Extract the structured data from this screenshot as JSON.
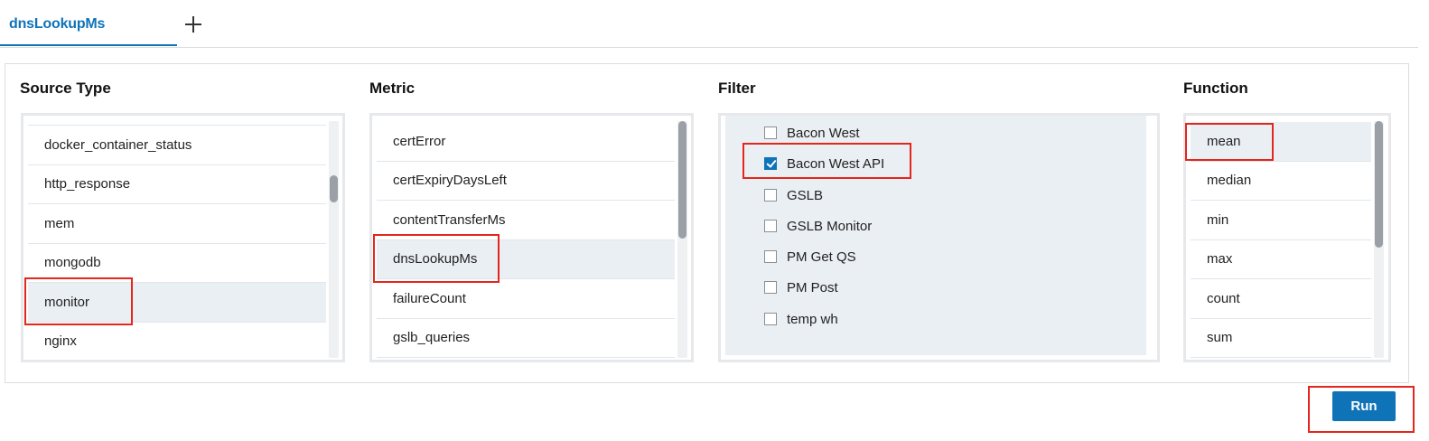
{
  "tabs": {
    "active_label": "dnsLookupMs",
    "add_icon": "plus-icon"
  },
  "source_type": {
    "title": "Source Type",
    "items": [
      "docker_container_status",
      "http_response",
      "mem",
      "mongodb",
      "monitor",
      "nginx"
    ],
    "selected": "monitor"
  },
  "metric": {
    "title": "Metric",
    "items": [
      "certError",
      "certExpiryDaysLeft",
      "contentTransferMs",
      "dnsLookupMs",
      "failureCount",
      "gslb_queries"
    ],
    "selected": "dnsLookupMs"
  },
  "filter": {
    "title": "Filter",
    "items": [
      {
        "label": "Bacon West",
        "checked": false
      },
      {
        "label": "Bacon West API",
        "checked": true
      },
      {
        "label": "GSLB",
        "checked": false
      },
      {
        "label": "GSLB Monitor",
        "checked": false
      },
      {
        "label": "PM Get QS",
        "checked": false
      },
      {
        "label": "PM Post",
        "checked": false
      },
      {
        "label": "temp wh",
        "checked": false
      }
    ]
  },
  "function": {
    "title": "Function",
    "items": [
      "mean",
      "median",
      "min",
      "max",
      "count",
      "sum"
    ],
    "selected": "mean"
  },
  "run_button": {
    "label": "Run"
  },
  "colors": {
    "accent": "#0f73b8",
    "highlight": "#e5261c",
    "selected_row": "#eaeff4"
  }
}
